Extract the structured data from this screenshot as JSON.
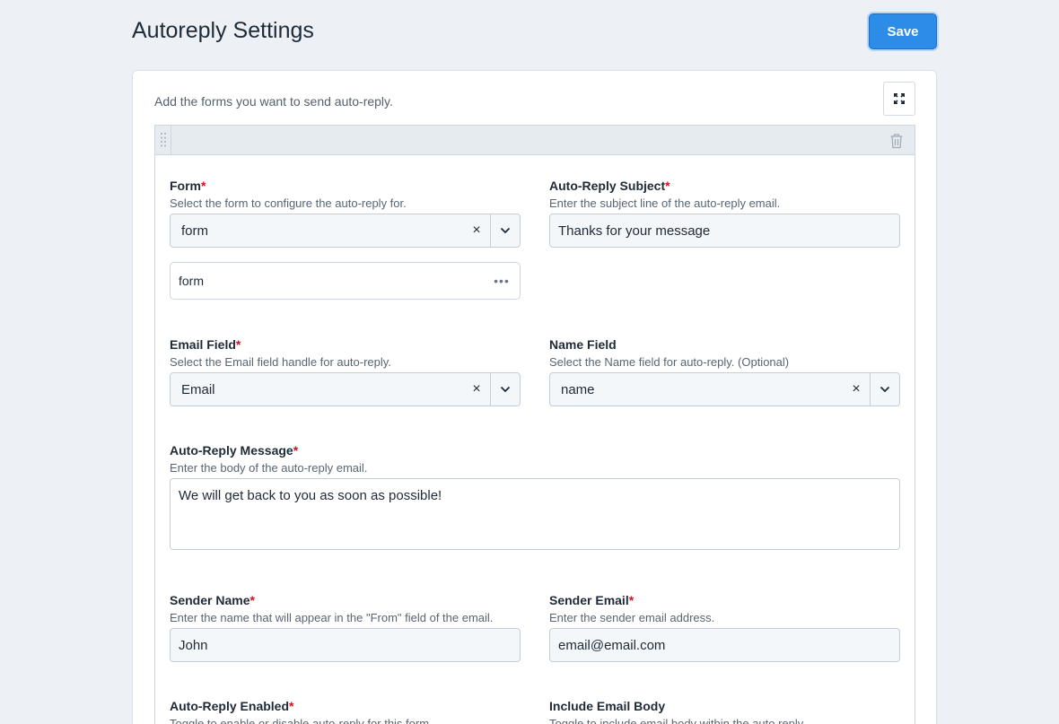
{
  "page": {
    "title": "Autoreply Settings",
    "save_label": "Save"
  },
  "card": {
    "instructions": "Add the forms you want to send auto-reply."
  },
  "fields": {
    "form": {
      "label": "Form",
      "required": "*",
      "hint": "Select the form to configure the auto-reply for.",
      "value": "form",
      "clear": "×",
      "element_label": "form",
      "element_menu": "•••"
    },
    "subject": {
      "label": "Auto-Reply Subject",
      "required": "*",
      "hint": "Enter the subject line of the auto-reply email.",
      "value": "Thanks for your message"
    },
    "email_field": {
      "label": "Email Field",
      "required": "*",
      "hint": "Select the Email field handle for auto-reply.",
      "value": "Email",
      "clear": "×"
    },
    "name_field": {
      "label": "Name Field",
      "hint": "Select the Name field for auto-reply. (Optional)",
      "value": "name",
      "clear": "×"
    },
    "message": {
      "label": "Auto-Reply Message",
      "required": "*",
      "hint": "Enter the body of the auto-reply email.",
      "value": "We will get back to you as soon as possible!"
    },
    "sender_name": {
      "label": "Sender Name",
      "required": "*",
      "hint": "Enter the name that will appear in the \"From\" field of the email.",
      "value": "John"
    },
    "sender_email": {
      "label": "Sender Email",
      "required": "*",
      "hint": "Enter the sender email address.",
      "value": "email@email.com"
    },
    "enabled": {
      "label": "Auto-Reply Enabled",
      "required": "*",
      "hint": "Toggle to enable or disable auto-reply for this form."
    },
    "include_body": {
      "label": "Include Email Body",
      "hint": "Toggle to include email body within the auto reply"
    }
  },
  "colors": {
    "accent": "#2d8ce8",
    "required": "#cf1124",
    "background": "#edf1f5"
  }
}
